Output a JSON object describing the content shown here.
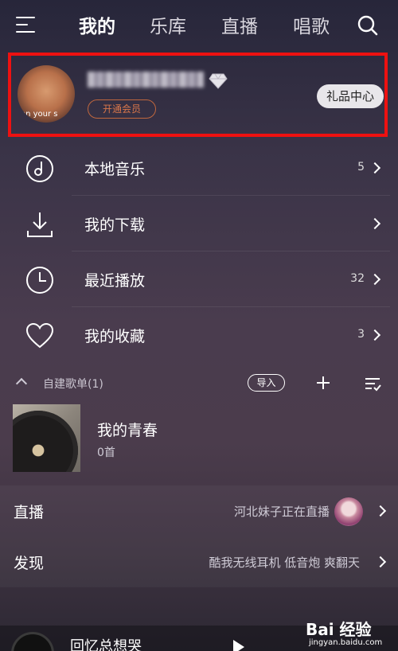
{
  "header": {
    "tabs": [
      {
        "label": "我的",
        "active": true
      },
      {
        "label": "乐库",
        "active": false
      },
      {
        "label": "直播",
        "active": false
      },
      {
        "label": "唱歌",
        "active": false
      }
    ],
    "icons": {
      "menu": "menu-icon",
      "search": "search-icon"
    }
  },
  "profile": {
    "avatar_text": "on your s",
    "vip_label": "开通会员",
    "gift_label": "礼品中心",
    "highlight_color": "#ee1111"
  },
  "menu_items": [
    {
      "label": "本地音乐",
      "count": "5",
      "icon": "music-disc-icon"
    },
    {
      "label": "我的下载",
      "count": "",
      "icon": "download-icon"
    },
    {
      "label": "最近播放",
      "count": "32",
      "icon": "clock-icon"
    },
    {
      "label": "我的收藏",
      "count": "3",
      "icon": "heart-icon"
    }
  ],
  "playlists": {
    "title": "自建歌单(1)",
    "import_label": "导入",
    "items": [
      {
        "title": "我的青春",
        "count": "0首"
      }
    ]
  },
  "sections": {
    "live": {
      "title": "直播",
      "desc": "河北妹子正在直播"
    },
    "discover": {
      "title": "发现",
      "desc": "酷我无线耳机 低音炮 爽翻天"
    }
  },
  "now_playing": {
    "song": "回忆总想哭"
  },
  "watermark": {
    "logo": "Bai 经验",
    "url": "jingyan.baidu.com"
  }
}
